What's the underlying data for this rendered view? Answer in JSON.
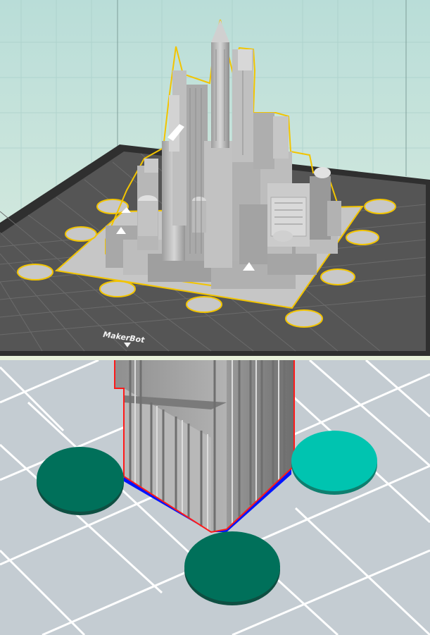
{
  "top_view": {
    "brand_label": "MakerBot",
    "colors": {
      "background_top": "#c2e2dc",
      "background_bottom": "#e6f0dc",
      "build_plate": "#545454",
      "plate_border": "#2e2e2e",
      "grid_line": "#6a6a6a",
      "model_gray": "#b3b3b3",
      "selection_outline": "#f2c400",
      "disc_fill": "#c8c8c8"
    },
    "icons": [
      "build-plate",
      "city-model",
      "brim-disc",
      "makerbot-logo"
    ]
  },
  "bottom_view": {
    "colors": {
      "background": "#c4ccd2",
      "grid_line": "#ffffff",
      "tower_gray": "#a7a7a7",
      "base_blue": "#0014ff",
      "edge_red": "#ff1a1a",
      "disc_dark": "#00705a",
      "disc_light": "#00c4b0"
    },
    "icons": [
      "tower-model",
      "support-disc-dark",
      "support-disc-light"
    ]
  }
}
